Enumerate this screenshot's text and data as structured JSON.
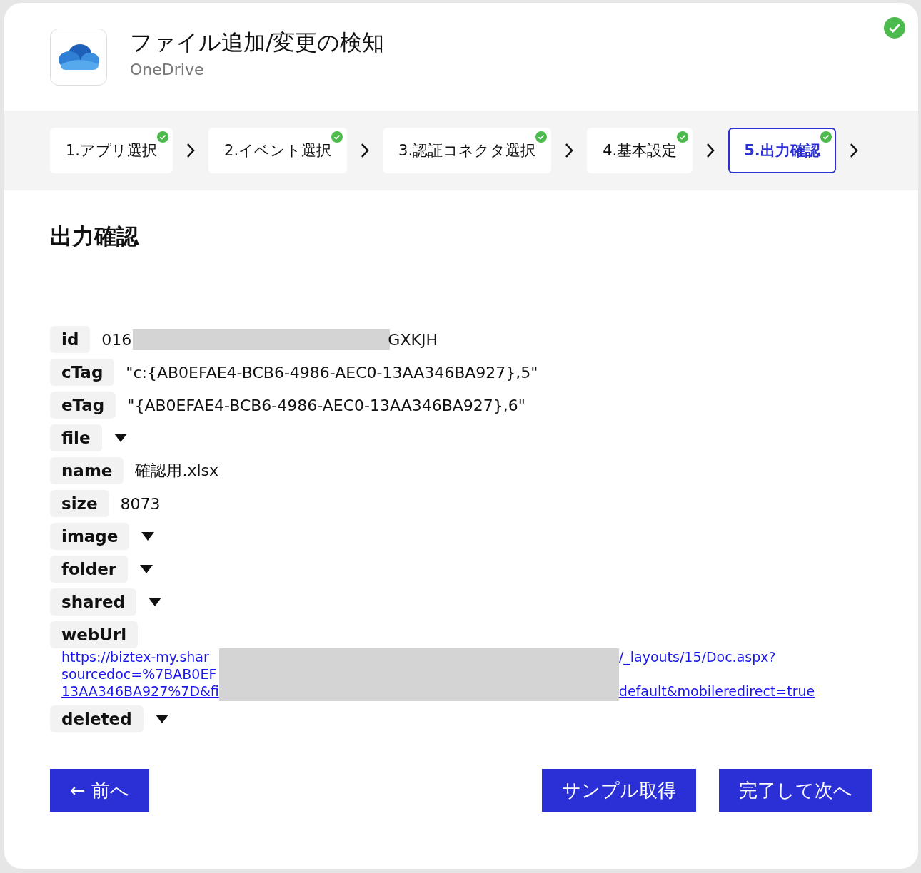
{
  "header": {
    "title": "ファイル追加/変更の検知",
    "subtitle": "OneDrive",
    "done": true
  },
  "steps": [
    {
      "label": "1.アプリ選択",
      "done": true,
      "selected": false
    },
    {
      "label": "2.イベント選択",
      "done": true,
      "selected": false
    },
    {
      "label": "3.認証コネクタ選択",
      "done": true,
      "selected": false
    },
    {
      "label": "4.基本設定",
      "done": true,
      "selected": false
    },
    {
      "label": "5.出力確認",
      "done": true,
      "selected": true
    }
  ],
  "section_title": "出力確認",
  "fields": [
    {
      "kind": "redacted",
      "key": "id",
      "prefix": "016",
      "suffix": "GXKJH"
    },
    {
      "kind": "value",
      "key": "cTag",
      "value": "\"c:{AB0EFAE4-BCB6-4986-AEC0-13AA346BA927},5\""
    },
    {
      "kind": "value",
      "key": "eTag",
      "value": "\"{AB0EFAE4-BCB6-4986-AEC0-13AA346BA927},6\""
    },
    {
      "kind": "object",
      "key": "file"
    },
    {
      "kind": "value",
      "key": "name",
      "value": "確認用.xlsx"
    },
    {
      "kind": "value",
      "key": "size",
      "value": "8073"
    },
    {
      "kind": "object",
      "key": "image"
    },
    {
      "kind": "object",
      "key": "folder"
    },
    {
      "kind": "object",
      "key": "shared"
    },
    {
      "kind": "link",
      "key": "webUrl",
      "lines": [
        {
          "prefix": "https://biztex-my.shar",
          "suffix": "/_layouts/15/Doc.aspx?"
        },
        {
          "prefix": "sourcedoc=%7BAB0EF"
        },
        {
          "prefix": "13AA346BA927%7D&fi",
          "suffix": "default&mobileredirect=true"
        }
      ]
    },
    {
      "kind": "object",
      "key": "deleted"
    }
  ],
  "buttons": {
    "back": "← 前へ",
    "sample": "サンプル取得",
    "next": "完了して次へ"
  }
}
